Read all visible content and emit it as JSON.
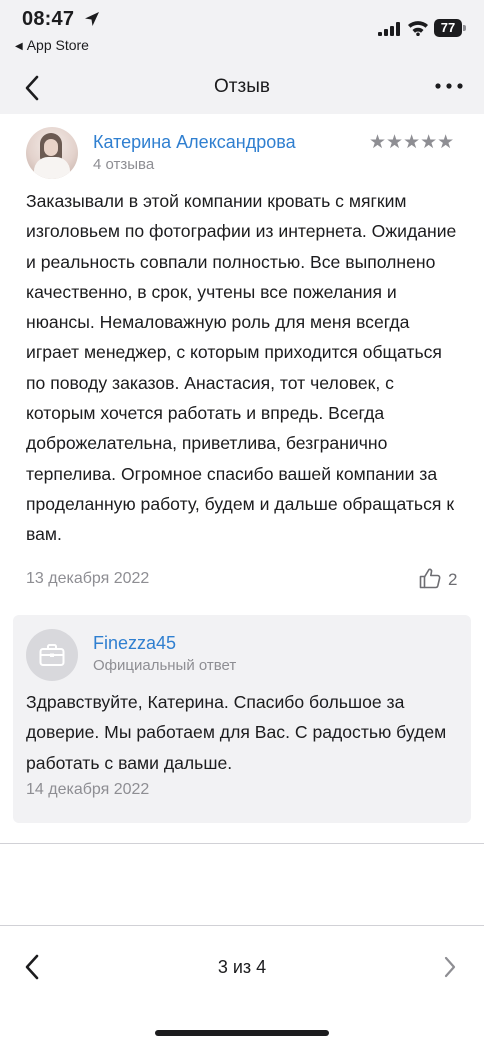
{
  "status_bar": {
    "time": "08:47",
    "back_app": "App Store",
    "battery": "77"
  },
  "nav": {
    "title": "Отзыв"
  },
  "review": {
    "author": "Катерина Александрова",
    "reviews_count": "4 отзыва",
    "rating": 5,
    "rating_max": 5,
    "stars": "★★★★★",
    "text": "Заказывали в этой компании кровать с мягким изголовьем по фотографии из интернета. Ожидание и реальность совпали полностью. Все выполнено качественно, в срок, учтены все пожелания и нюансы. Немаловажную роль для меня всегда играет менеджер, с которым приходится общаться по поводу заказов. Анастасия, тот человек, с которым хочется работать и впредь. Всегда доброжелательна, приветлива, безгранично терпелива. Огромное спасибо вашей компании за проделанную работу, будем и дальше обращаться к вам.",
    "date": "13 декабря 2022",
    "likes": "2"
  },
  "reply": {
    "author": "Finezza45",
    "role": "Официальный ответ",
    "text": "Здравствуйте, Катерина. Спасибо большое за доверие. Мы работаем для Вас. С радостью будем работать с вами дальше.",
    "date": "14 декабря 2022"
  },
  "pager": {
    "label": "3 из 4"
  },
  "colors": {
    "accent": "#2f7fd0",
    "secondary_text": "#8e8e93",
    "bar_background": "#f2f2f4"
  },
  "icons": [
    "location-arrow-icon",
    "signal-icon",
    "wifi-icon",
    "battery-icon",
    "chevron-left-icon",
    "more-icon",
    "thumbs-up-icon",
    "briefcase-icon",
    "chevron-right-icon"
  ]
}
